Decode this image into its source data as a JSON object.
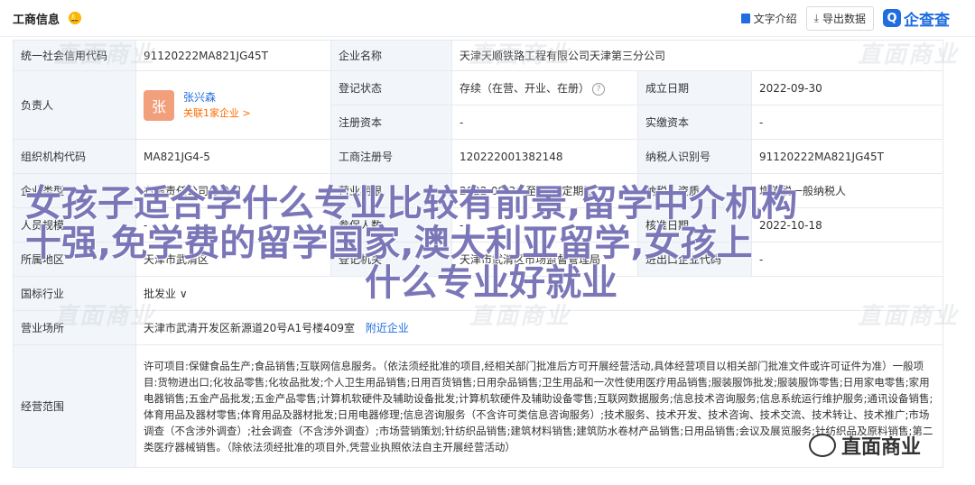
{
  "header": {
    "title": "工商信息",
    "intro_label": "文字介绍",
    "export_label": "导出数据",
    "brand": "企查查",
    "brand_logo_char": "Q"
  },
  "rows": {
    "credit_code_label": "统一社会信用代码",
    "credit_code_value": "91120222MA821JG45T",
    "company_name_label": "企业名称",
    "company_name_value": "天津天顺铁路工程有限公司天津第三分公司",
    "legal_rep_label": "负责人",
    "person_avatar_char": "张",
    "person_name": "张兴森",
    "person_link": "关联1家企业 >",
    "reg_status_label": "登记状态",
    "reg_status_value": "存续（在营、开业、在册）",
    "established_label": "成立日期",
    "established_value": "2022-09-30",
    "reg_capital_label": "注册资本",
    "reg_capital_value": "-",
    "paid_capital_label": "实缴资本",
    "paid_capital_value": "-",
    "org_code_label": "组织机构代码",
    "org_code_value": "MA821JG4-5",
    "reg_no_label": "工商注册号",
    "reg_no_value": "120222001382148",
    "taxpayer_id_label": "纳税人识别号",
    "taxpayer_id_value": "91120222MA821JG45T",
    "company_type_label": "企业类型",
    "company_type_value": "有限责任公司分公司",
    "term_label": "营业期限",
    "term_value": "2022-09-30 至 无固定期限",
    "taxpayer_qual_label": "纳税人资质",
    "taxpayer_qual_value": "增值税一般纳税人",
    "staff_label": "人员规模",
    "staff_value": "-",
    "insured_label": "参保人数",
    "insured_value": "-",
    "approval_date_label": "核准日期",
    "approval_date_value": "2022-10-18",
    "region_label": "所属地区",
    "region_value": "天津市武清区",
    "authority_label": "登记机关",
    "authority_value": "天津市武清区市场监督管理局",
    "import_export_label": "进出口企业代码",
    "import_export_value": "-",
    "industry_label": "国标行业",
    "industry_value": "批发业 ∨",
    "address_label": "营业场所",
    "address_value": "天津市武清开发区新源道20号A1号楼409室",
    "nearby_label": "附近企业",
    "scope_label": "经营范围",
    "scope_value": "许可项目:保健食品生产;食品销售;互联网信息服务。（依法须经批准的项目,经相关部门批准后方可开展经营活动,具体经营项目以相关部门批准文件或许可证件为准）一般项目:货物进出口;化妆品零售;化妆品批发;个人卫生用品销售;日用百货销售;日用杂品销售;卫生用品和一次性使用医疗用品销售;服装服饰批发;服装服饰零售;日用家电零售;家用电器销售;五金产品批发;五金产品零售;计算机软硬件及辅助设备批发;计算机软硬件及辅助设备零售;互联网数据服务;信息技术咨询服务;信息系统运行维护服务;通讯设备销售;体育用品及器材零售;体育用品及器材批发;日用电器修理;信息咨询服务（不含许可类信息咨询服务）;技术服务、技术开发、技术咨询、技术交流、技术转让、技术推广;市场调查（不含涉外调查）;社会调查（不含涉外调查）;市场营销策划;针纺织品销售;建筑材料销售;建筑防水卷材产品销售;日用品销售;会议及展览服务;针纺织品及原料销售;第二类医疗器械销售。（除依法须经批准的项目外,凭营业执照依法自主开展经营活动）"
  },
  "watermark_text": "直面商业",
  "overlay": {
    "line1": "女孩子适合学什么专业比较有前景,留学中介机构",
    "line2": "十强,免学费的留学国家,澳大利亚留学,女孩上",
    "line3": "什么专业好就业"
  },
  "wechat_label": "直面商业"
}
